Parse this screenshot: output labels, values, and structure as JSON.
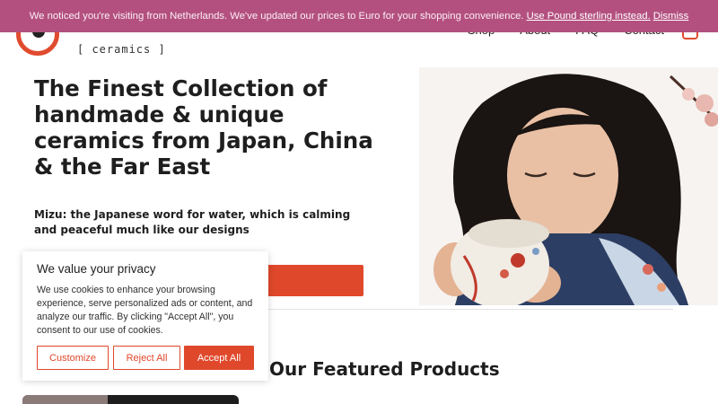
{
  "brand": {
    "tagline": "[ ceramics ]",
    "accent_color": "#e0482b"
  },
  "notice": {
    "message": "We noticed you're visiting from Netherlands. We've updated our prices to Euro for your shopping convenience.",
    "switch_link": "Use Pound sterling instead.",
    "dismiss_link": "Dismiss",
    "background": "#b3507f"
  },
  "nav": {
    "items": [
      "Shop",
      "About",
      "FAQ",
      "Contact"
    ],
    "cart_icon": "shopping-bag-icon"
  },
  "hero": {
    "title": "The Finest Collection of handmade & unique ceramics from Japan, China & the Far East",
    "subtitle": "Mizu: the Japanese word for water, which is calming and peaceful much like our designs"
  },
  "featured": {
    "heading": "Our Featured Products"
  },
  "cookie": {
    "title": "We value your privacy",
    "text": "We use cookies to enhance your browsing experience, serve personalized ads or content, and analyze our traffic. By clicking \"Accept All\", you consent to our use of cookies.",
    "customize_label": "Customize",
    "reject_label": "Reject All",
    "accept_label": "Accept All"
  }
}
